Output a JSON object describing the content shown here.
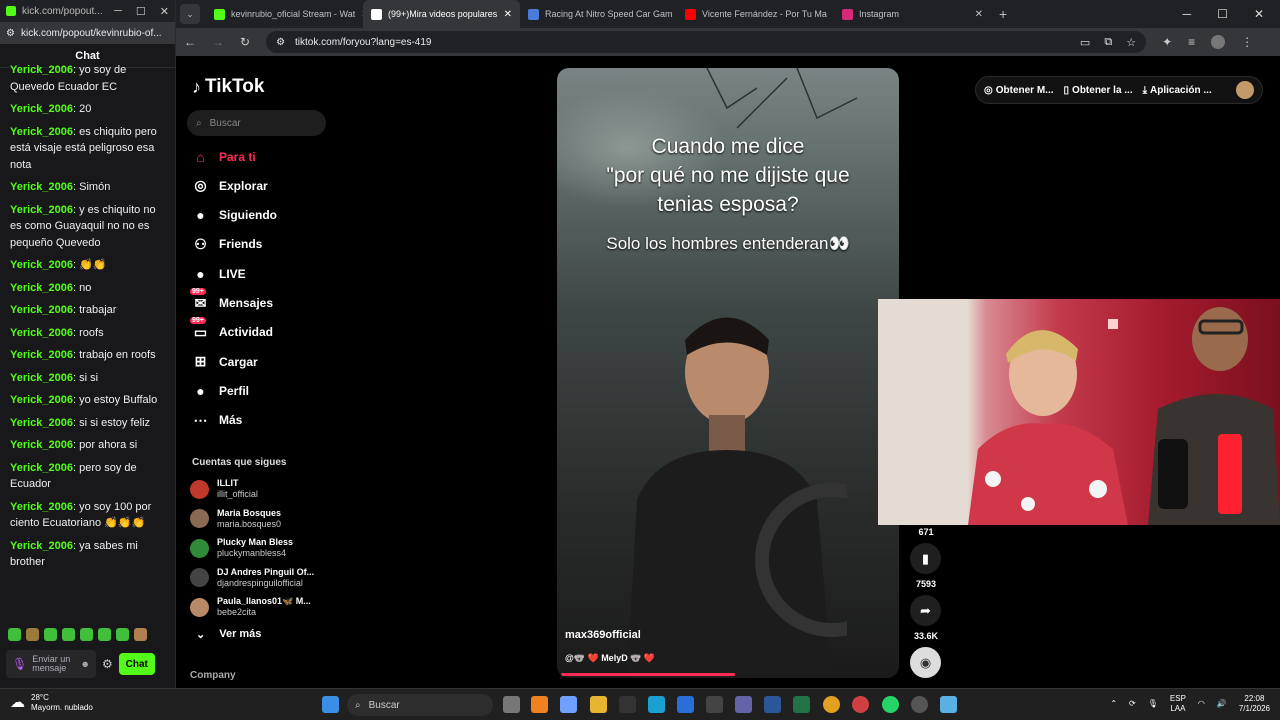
{
  "popup": {
    "title": "kick.com/popout...",
    "url": "kick.com/popout/kevinrubio-of...",
    "chat_title": "Chat",
    "messages": [
      {
        "user": "Yerick_2006",
        "text": ": yo soy de Quevedo Ecuador EC"
      },
      {
        "user": "Yerick_2006",
        "text": ": 20"
      },
      {
        "user": "Yerick_2006",
        "text": ": es chiquito pero está visaje está peligroso esa nota"
      },
      {
        "user": "Yerick_2006",
        "text": ": Simón"
      },
      {
        "user": "Yerick_2006",
        "text": ": y es chiquito no es como Guayaquil no no es pequeño Quevedo"
      },
      {
        "user": "Yerick_2006",
        "text": ": 👏👏"
      },
      {
        "user": "Yerick_2006",
        "text": ": no"
      },
      {
        "user": "Yerick_2006",
        "text": ": trabajar"
      },
      {
        "user": "Yerick_2006",
        "text": ": roofs"
      },
      {
        "user": "Yerick_2006",
        "text": ": trabajo en roofs"
      },
      {
        "user": "Yerick_2006",
        "text": ": si si"
      },
      {
        "user": "Yerick_2006",
        "text": ": yo estoy Buffalo"
      },
      {
        "user": "Yerick_2006",
        "text": ": si si estoy feliz"
      },
      {
        "user": "Yerick_2006",
        "text": ": por ahora si"
      },
      {
        "user": "Yerick_2006",
        "text": ": pero soy de Ecuador"
      },
      {
        "user": "Yerick_2006",
        "text": ": yo soy 100 por ciento Ecuatoriano 👏👏👏"
      },
      {
        "user": "Yerick_2006",
        "text": ": ya sabes mi brother"
      }
    ],
    "input_placeholder": "Enviar un mensaje",
    "send_label": "Chat"
  },
  "browser": {
    "tabs": [
      {
        "title": "kevinrubio_oficial Stream - Wat",
        "color": "#53fc18"
      },
      {
        "title": "(99+)Mira videos populares",
        "color": "#ffffff"
      },
      {
        "title": "Racing At Nitro Speed Car Gam",
        "color": "#4a7bd8"
      },
      {
        "title": "Vicente Fernández - Por Tu Ma",
        "color": "#ff0000"
      },
      {
        "title": "Instagram",
        "color": "#d62976"
      }
    ],
    "url": "tiktok.com/foryou?lang=es-419"
  },
  "tiktok": {
    "logo": "TikTok",
    "search_placeholder": "Buscar",
    "nav": [
      {
        "label": "Para ti",
        "icon": "home-icon"
      },
      {
        "label": "Explorar",
        "icon": "compass-icon"
      },
      {
        "label": "Siguiendo",
        "icon": "following-icon"
      },
      {
        "label": "Friends",
        "icon": "friends-icon"
      },
      {
        "label": "LIVE",
        "icon": "live-icon"
      },
      {
        "label": "Mensajes",
        "icon": "messages-icon",
        "badge": "99+"
      },
      {
        "label": "Actividad",
        "icon": "activity-icon",
        "badge": "99+"
      },
      {
        "label": "Cargar",
        "icon": "upload-icon"
      },
      {
        "label": "Perfil",
        "icon": "profile-icon"
      },
      {
        "label": "Más",
        "icon": "more-icon"
      }
    ],
    "following_title": "Cuentas que sigues",
    "accounts": [
      {
        "name": "ILLIT",
        "handle": "illit_official",
        "color": "#c0392b"
      },
      {
        "name": "Maria Bosques",
        "handle": "maria.bosques0",
        "color": "#8a6a50"
      },
      {
        "name": "Plucky Man Bless",
        "handle": "pluckymanbless4",
        "color": "#2f8a3a"
      },
      {
        "name": "DJ Andres Pinguil Of...",
        "handle": "djandrespinguilofficial",
        "color": "#444444"
      },
      {
        "name": "Paula_llanos01🦋 M...",
        "handle": "bebe2cita",
        "color": "#b88a6a"
      }
    ],
    "more_label": "Ver más",
    "company": "Company",
    "top_bar": [
      "Obtener M...",
      "Obtener la ...",
      "Aplicación ..."
    ],
    "video": {
      "caption_lines": [
        "Cuando me dice",
        "\"por qué no me dijiste que",
        "tenias esposa?"
      ],
      "subcaption": "Solo los hombres entenderan👀",
      "author": "max369official",
      "music": "@🐨 ❤️ MelyD 🐨 ❤️",
      "progress": 0.52
    },
    "counts": {
      "comments": "671",
      "saves": "7593",
      "shares": "33.6K"
    }
  },
  "taskbar": {
    "temp": "28°C",
    "weather": "Mayorm. nublado",
    "search": "Buscar",
    "lang1": "ESP",
    "lang2": "LAA",
    "time": "22:08",
    "date": "7/1/2026"
  }
}
